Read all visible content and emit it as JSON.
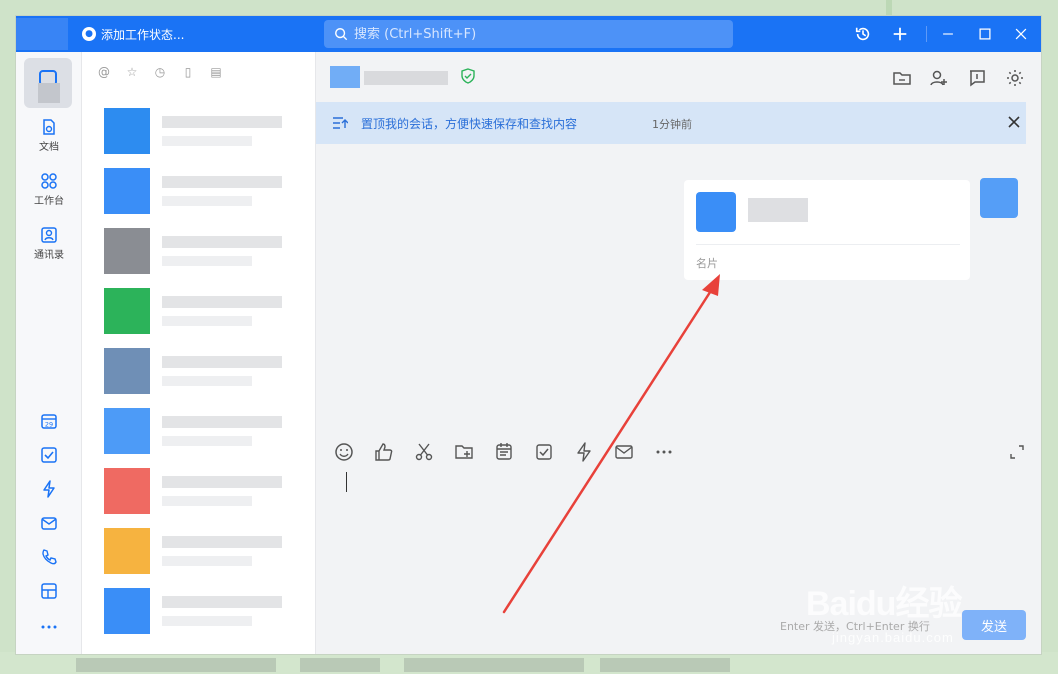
{
  "titlebar": {
    "status_label": "添加工作状态...",
    "search_placeholder": "搜索 (Ctrl+Shift+F)"
  },
  "leftnav": {
    "items": [
      {
        "label": "文档"
      },
      {
        "label": "工作台"
      },
      {
        "label": "通讯录"
      }
    ],
    "calendar_day": "29"
  },
  "banner": {
    "text": "置顶我的会话，方便快速保存和查找内容",
    "time": "1分钟前"
  },
  "message_card": {
    "label": "名片"
  },
  "editor": {
    "hint": "Enter 发送，Ctrl+Enter 换行",
    "send_label": "发送"
  },
  "watermark": {
    "text": "Baidu经验",
    "sub": "jingyan.baidu.com"
  },
  "colors": {
    "primary": "#1a73f5",
    "banner_bg": "#d6e5f7",
    "arrow": "#e8413a"
  },
  "conversations": [
    {
      "avatar_color": "#2d8cf0"
    },
    {
      "avatar_color": "#3a8ef7"
    },
    {
      "avatar_color": "#8a8d93"
    },
    {
      "avatar_color": "#2cb35a"
    },
    {
      "avatar_color": "#6f8fb6"
    },
    {
      "avatar_color": "#4d9bf7"
    },
    {
      "avatar_color": "#ef6a62"
    },
    {
      "avatar_color": "#f6b340"
    },
    {
      "avatar_color": "#3a8ef7"
    }
  ]
}
